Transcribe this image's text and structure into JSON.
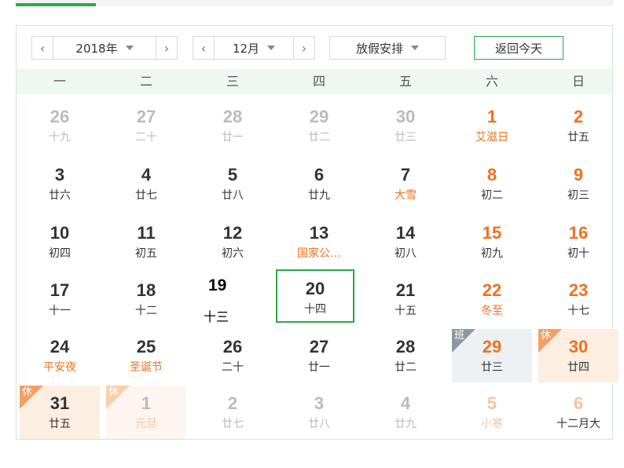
{
  "toolbar": {
    "year_label": "2018年",
    "month_label": "12月",
    "holiday_label": "放假安排",
    "today_label": "返回今天",
    "prev_icon": "‹",
    "next_icon": "›"
  },
  "weekdays": [
    "一",
    "二",
    "三",
    "四",
    "五",
    "六",
    "日"
  ],
  "days": [
    {
      "d": "26",
      "l": "十九",
      "other": true
    },
    {
      "d": "27",
      "l": "二十",
      "other": true
    },
    {
      "d": "28",
      "l": "廿一",
      "other": true
    },
    {
      "d": "29",
      "l": "廿二",
      "other": true
    },
    {
      "d": "30",
      "l": "廿三",
      "other": true
    },
    {
      "d": "1",
      "l": "艾滋日",
      "weekend": true,
      "festival": true
    },
    {
      "d": "2",
      "l": "廿五",
      "weekend": true
    },
    {
      "d": "3",
      "l": "廿六"
    },
    {
      "d": "4",
      "l": "廿七"
    },
    {
      "d": "5",
      "l": "廿八"
    },
    {
      "d": "6",
      "l": "廿九"
    },
    {
      "d": "7",
      "l": "大雪",
      "festival": true
    },
    {
      "d": "8",
      "l": "初二",
      "weekend": true
    },
    {
      "d": "9",
      "l": "初三",
      "weekend": true
    },
    {
      "d": "10",
      "l": "初四"
    },
    {
      "d": "11",
      "l": "初五"
    },
    {
      "d": "12",
      "l": "初六"
    },
    {
      "d": "13",
      "l": "国家公…",
      "festival": true
    },
    {
      "d": "14",
      "l": "初八"
    },
    {
      "d": "15",
      "l": "初九",
      "weekend": true
    },
    {
      "d": "16",
      "l": "初十",
      "weekend": true
    },
    {
      "d": "17",
      "l": "十一"
    },
    {
      "d": "18",
      "l": "十二"
    },
    {
      "d": "19",
      "l": "十三",
      "plain": true
    },
    {
      "d": "20",
      "l": "十四",
      "today": true
    },
    {
      "d": "21",
      "l": "十五"
    },
    {
      "d": "22",
      "l": "冬至",
      "weekend": true,
      "festival": true
    },
    {
      "d": "23",
      "l": "十七",
      "weekend": true
    },
    {
      "d": "24",
      "l": "平安夜",
      "festival": true
    },
    {
      "d": "25",
      "l": "圣诞节",
      "festival": true
    },
    {
      "d": "26",
      "l": "二十"
    },
    {
      "d": "27",
      "l": "廿一"
    },
    {
      "d": "28",
      "l": "廿二"
    },
    {
      "d": "29",
      "l": "廿三",
      "weekend": true,
      "work": true,
      "tag": "班"
    },
    {
      "d": "30",
      "l": "廿四",
      "weekend": true,
      "rest": true,
      "tag": "休"
    },
    {
      "d": "31",
      "l": "廿五",
      "rest": true,
      "tag": "休",
      "bold": true
    },
    {
      "d": "1",
      "l": "元旦",
      "other": true,
      "festival": true,
      "rest": true,
      "faded": true,
      "tag": "休"
    },
    {
      "d": "2",
      "l": "廿七",
      "other": true
    },
    {
      "d": "3",
      "l": "廿八",
      "other": true
    },
    {
      "d": "4",
      "l": "廿九",
      "other": true
    },
    {
      "d": "5",
      "l": "小寒",
      "other": true,
      "weekend": true,
      "festival": true
    },
    {
      "d": "6",
      "l": "十二月大",
      "other": true,
      "weekend": true
    }
  ]
}
